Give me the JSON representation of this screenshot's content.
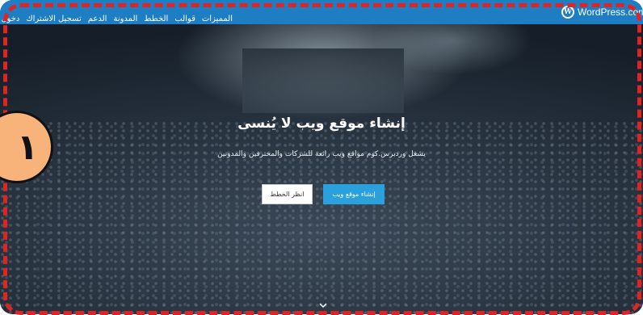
{
  "brand": {
    "logo_letter": "W",
    "name": "WordPress.com"
  },
  "nav": {
    "items": [
      "المميزات",
      "قوالب",
      "الخطط",
      "المدونة",
      "الدعم",
      "تسجيل الاشتراك",
      "دخول"
    ]
  },
  "hero": {
    "title": "إنشاء موقع ويب لا يُنسى",
    "subtitle": "يشغل وردبرس.كوم مواقع ويب رائعة للشركات والمحترفين والمدونين",
    "primary_button": "إنشاء موقع ويب",
    "secondary_button": "انظر الخطط"
  },
  "annotation": {
    "badge_number": "١",
    "border_color": "#e02424",
    "badge_color": "#f7b37a"
  },
  "colors": {
    "topbar": "#1e7ec4",
    "primary_button": "#2aa0dc"
  },
  "icons": {
    "scroll_down": "chevron-down-icon",
    "logo": "wordpress-logo-icon"
  }
}
